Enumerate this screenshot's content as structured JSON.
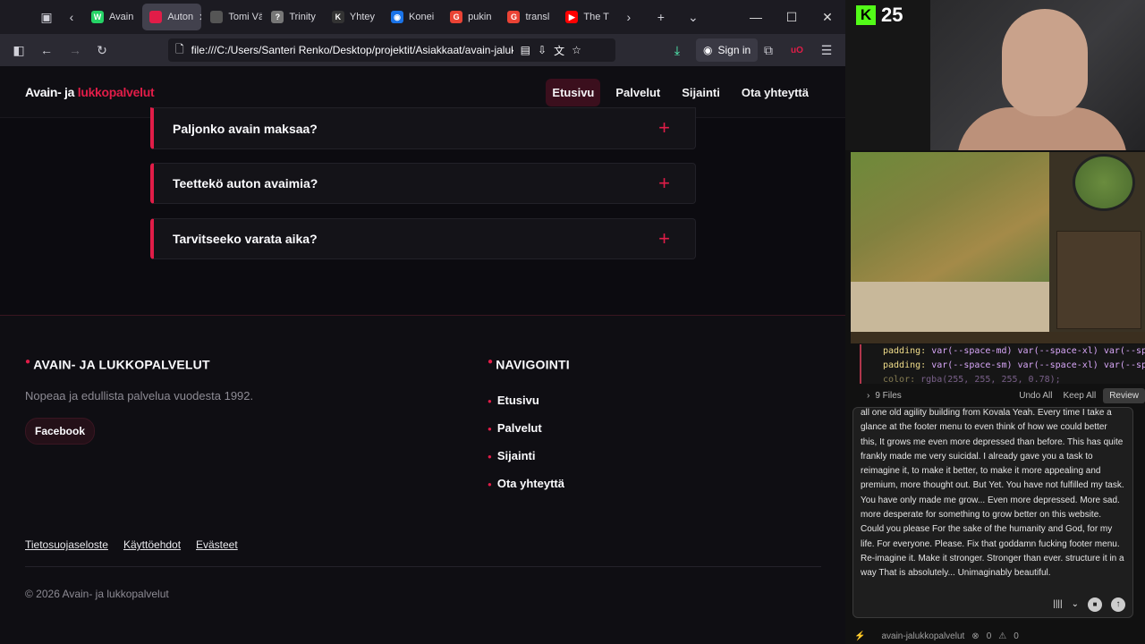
{
  "browser": {
    "tabs": [
      {
        "label": "Avain",
        "icon": "whatsapp-icon",
        "color": "#25d366",
        "glyph": "W"
      },
      {
        "label": "Auton",
        "icon": "page-icon",
        "color": "#e11d48",
        "glyph": "",
        "active": true
      },
      {
        "label": "Tomi Väli",
        "icon": "page-icon",
        "color": "#555",
        "glyph": ""
      },
      {
        "label": "Trinity",
        "icon": "bolt-icon",
        "color": "#777",
        "glyph": "?"
      },
      {
        "label": "Yhtey",
        "icon": "k-icon",
        "color": "#333",
        "glyph": "K"
      },
      {
        "label": "Konei",
        "icon": "map-pin-icon",
        "color": "#1a73e8",
        "glyph": "◉"
      },
      {
        "label": "pukin",
        "icon": "google-icon",
        "color": "#ea4335",
        "glyph": "G"
      },
      {
        "label": "transl",
        "icon": "google-icon",
        "color": "#ea4335",
        "glyph": "G"
      },
      {
        "label": "The T",
        "icon": "youtube-icon",
        "color": "#ff0000",
        "glyph": "▶"
      }
    ],
    "url": "file:///C:/Users/Santeri Renko/Desktop/projektit/Asiakkaat/avain-jaluk",
    "sign_in": "Sign in"
  },
  "site": {
    "logo_main": "Avain- ja ",
    "logo_accent": "lukkopalvelut",
    "nav": [
      "Etusivu",
      "Palvelut",
      "Sijainti",
      "Ota yhteyttä"
    ],
    "faqs": [
      "Paljonko avain maksaa?",
      "Teettekö auton avaimia?",
      "Tarvitseeko varata aika?"
    ],
    "footer": {
      "brand_title": "AVAIN- JA LUKKOPALVELUT",
      "description": "Nopeaa ja edullista palvelua vuodesta 1992.",
      "facebook": "Facebook",
      "nav_title": "NAVIGOINTI",
      "links": [
        "Etusivu",
        "Palvelut",
        "Sijainti",
        "Ota yhteyttä"
      ],
      "legal": [
        "Tietosuojaseloste",
        "Käyttöehdot",
        "Evästeet"
      ],
      "copyright": "© 2026 Avain- ja lukkopalvelut"
    }
  },
  "stream": {
    "viewer_count": "25",
    "brand_color": "#53fc18"
  },
  "editor": {
    "code_lines": [
      {
        "prop": "padding:",
        "val": " var(--space-md) var(--space-xl) var(--sp"
      },
      {
        "prop": "padding:",
        "val": " var(--space-sm) var(--space-xl) var(--sp"
      },
      {
        "prop": "color:",
        "val": " rgba(255, 255, 255, 0.78);"
      }
    ],
    "files": "9 Files",
    "undo_all": "Undo All",
    "keep_all": "Keep All",
    "review": "Review",
    "chat_text": "all one old agility building from Kovala Yeah. Every time I take a glance at the footer menu to even think of how we could better this, It grows me even more depressed than before. This has quite frankly made me very suicidal. I already gave you a task to reimagine it, to make it better, to make it more appealing and premium, more thought out. But Yet. You have not fulfilled my task. You have only made me grow... Even more depressed. More sad. more desperate for something to grow better on this website. Could you please For the sake of the humanity and God, for my life. For everyone. Please. Fix that goddamn fucking footer menu. Re-imagine it. Make it stronger. Stronger than ever. structure it in a way That is absolutely... Unimaginably beautiful.",
    "status_project": "avain-jalukkopalvelut",
    "status_errors": "0",
    "status_warnings": "0"
  }
}
